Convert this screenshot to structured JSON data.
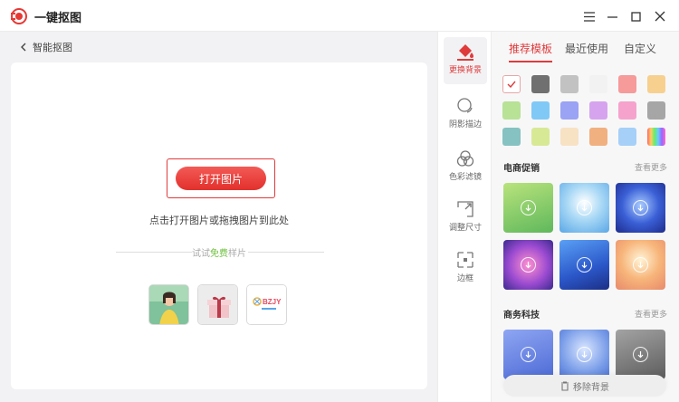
{
  "app": {
    "title": "一键抠图",
    "logo_icon": "red-logo-icon"
  },
  "window_controls": [
    "menu-icon",
    "minimize-icon",
    "maximize-icon",
    "close-icon"
  ],
  "nav": {
    "back_label": "智能抠图"
  },
  "canvas": {
    "open_button": "打开图片",
    "drop_hint": "点击打开图片或拖拽图片到此处",
    "sample_prefix": "试试",
    "sample_free": "免费",
    "sample_suffix": "样片",
    "samples": [
      {
        "name": "girl-photo",
        "thumb_label": ""
      },
      {
        "name": "gift-box-photo",
        "thumb_label": ""
      },
      {
        "name": "logo-sample",
        "thumb_label": "BZJY"
      }
    ]
  },
  "tools": [
    {
      "label": "更换背景",
      "icon": "paint-bucket-icon",
      "active": true
    },
    {
      "label": "阴影描边",
      "icon": "shadow-circle-icon",
      "active": false
    },
    {
      "label": "色彩滤镜",
      "icon": "color-filter-icon",
      "active": false
    },
    {
      "label": "调整尺寸",
      "icon": "resize-icon",
      "active": false
    },
    {
      "label": "边框",
      "icon": "border-icon",
      "active": false
    }
  ],
  "panel": {
    "tabs": [
      {
        "label": "推荐模板",
        "active": true
      },
      {
        "label": "最近使用",
        "active": false
      },
      {
        "label": "自定义",
        "active": false
      }
    ],
    "colors": [
      "none",
      "#707070",
      "#c2c2c2",
      "#f2f2f2",
      "#f69a9a",
      "#f7d08f",
      "#b8e296",
      "#80c9f7",
      "#9aa3f4",
      "#d6a4ee",
      "#f5a3cc",
      "#a6a6a6",
      "#86c2c1",
      "#d8e996",
      "#f7e2c4",
      "#f1b080",
      "#a6d0f7",
      "gradient"
    ],
    "sections": [
      {
        "title": "电商促销",
        "more": "查看更多",
        "thumbs": [
          "linear-gradient(160deg, #b9e37c, #5fb85c)",
          "radial-gradient(circle at 50% 40%, #ffffff, #a8d8f5 45%, #5aa7e6)",
          "radial-gradient(circle at 50% 45%, #a8cbff, #3a5fd6 50%, #1e2c8c)",
          "radial-gradient(circle at 50% 50%, #ff8fcf, #9b4bd1 55%, #3b2a8f)",
          "linear-gradient(160deg, #5aa0f5, #2b57c9 60%, #1c2f85)",
          "radial-gradient(circle at 50% 40%, #fff4d6, #f7b57a 50%, #e88a6b)"
        ]
      },
      {
        "title": "商务科技",
        "more": "查看更多",
        "thumbs": [
          "linear-gradient(160deg, #8fa6f2, #4c6ad6)",
          "radial-gradient(circle at 50% 40%, #d9e6ff, #7a9de8 60%, #4d6fd0)",
          "linear-gradient(160deg, #a3a3a3, #5c5c5c)"
        ]
      }
    ],
    "remove_bg": "移除背景"
  }
}
